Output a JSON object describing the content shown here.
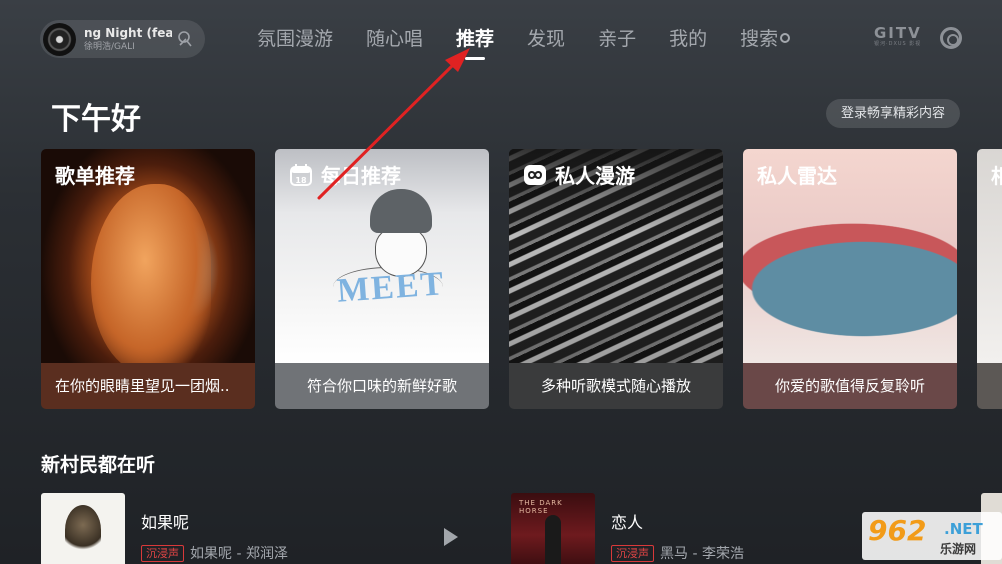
{
  "now_playing": {
    "title": "ng Night (feat.",
    "artist": "徐明浩/GALI",
    "icon": "share-icon"
  },
  "tabs": [
    {
      "label": "氛围漫游",
      "active": false
    },
    {
      "label": "随心唱",
      "active": false
    },
    {
      "label": "推荐",
      "active": true
    },
    {
      "label": "发现",
      "active": false
    },
    {
      "label": "亲子",
      "active": false
    },
    {
      "label": "我的",
      "active": false
    },
    {
      "label": "搜索",
      "active": false
    }
  ],
  "brand": {
    "name": "GITV",
    "sub": "银河·DXUS 影视"
  },
  "greeting": "下午好",
  "login_button": "登录畅享精彩内容",
  "cards": [
    {
      "title": "歌单推荐",
      "icon": "",
      "subtitle": "在你的眼睛里望见一团烟.."
    },
    {
      "title": "每日推荐",
      "icon": "calendar-icon",
      "calendar_day": "18",
      "subtitle": "符合你口味的新鲜好歌",
      "art_text": "MEET"
    },
    {
      "title": "私人漫游",
      "icon": "infinity-icon",
      "subtitle": "多种听歌模式随心播放"
    },
    {
      "title": "私人雷达",
      "icon": "",
      "subtitle": "你爱的歌值得反复聆听"
    },
    {
      "title": "相",
      "icon": "",
      "subtitle": ""
    }
  ],
  "section_title": "新村民都在听",
  "songs": [
    {
      "name": "如果呢",
      "badge": "沉浸声",
      "meta": "如果呢 - 郑润泽"
    },
    {
      "name": "恋人",
      "badge": "沉浸声",
      "meta": "黑马 - 李荣浩",
      "thumb_label": "THE DARK HORSE"
    }
  ],
  "watermark": {
    "num": "962",
    "net": ".NET",
    "cn": "乐游网"
  },
  "colors": {
    "annotation_arrow": "#e02222",
    "badge": "#e24545"
  }
}
